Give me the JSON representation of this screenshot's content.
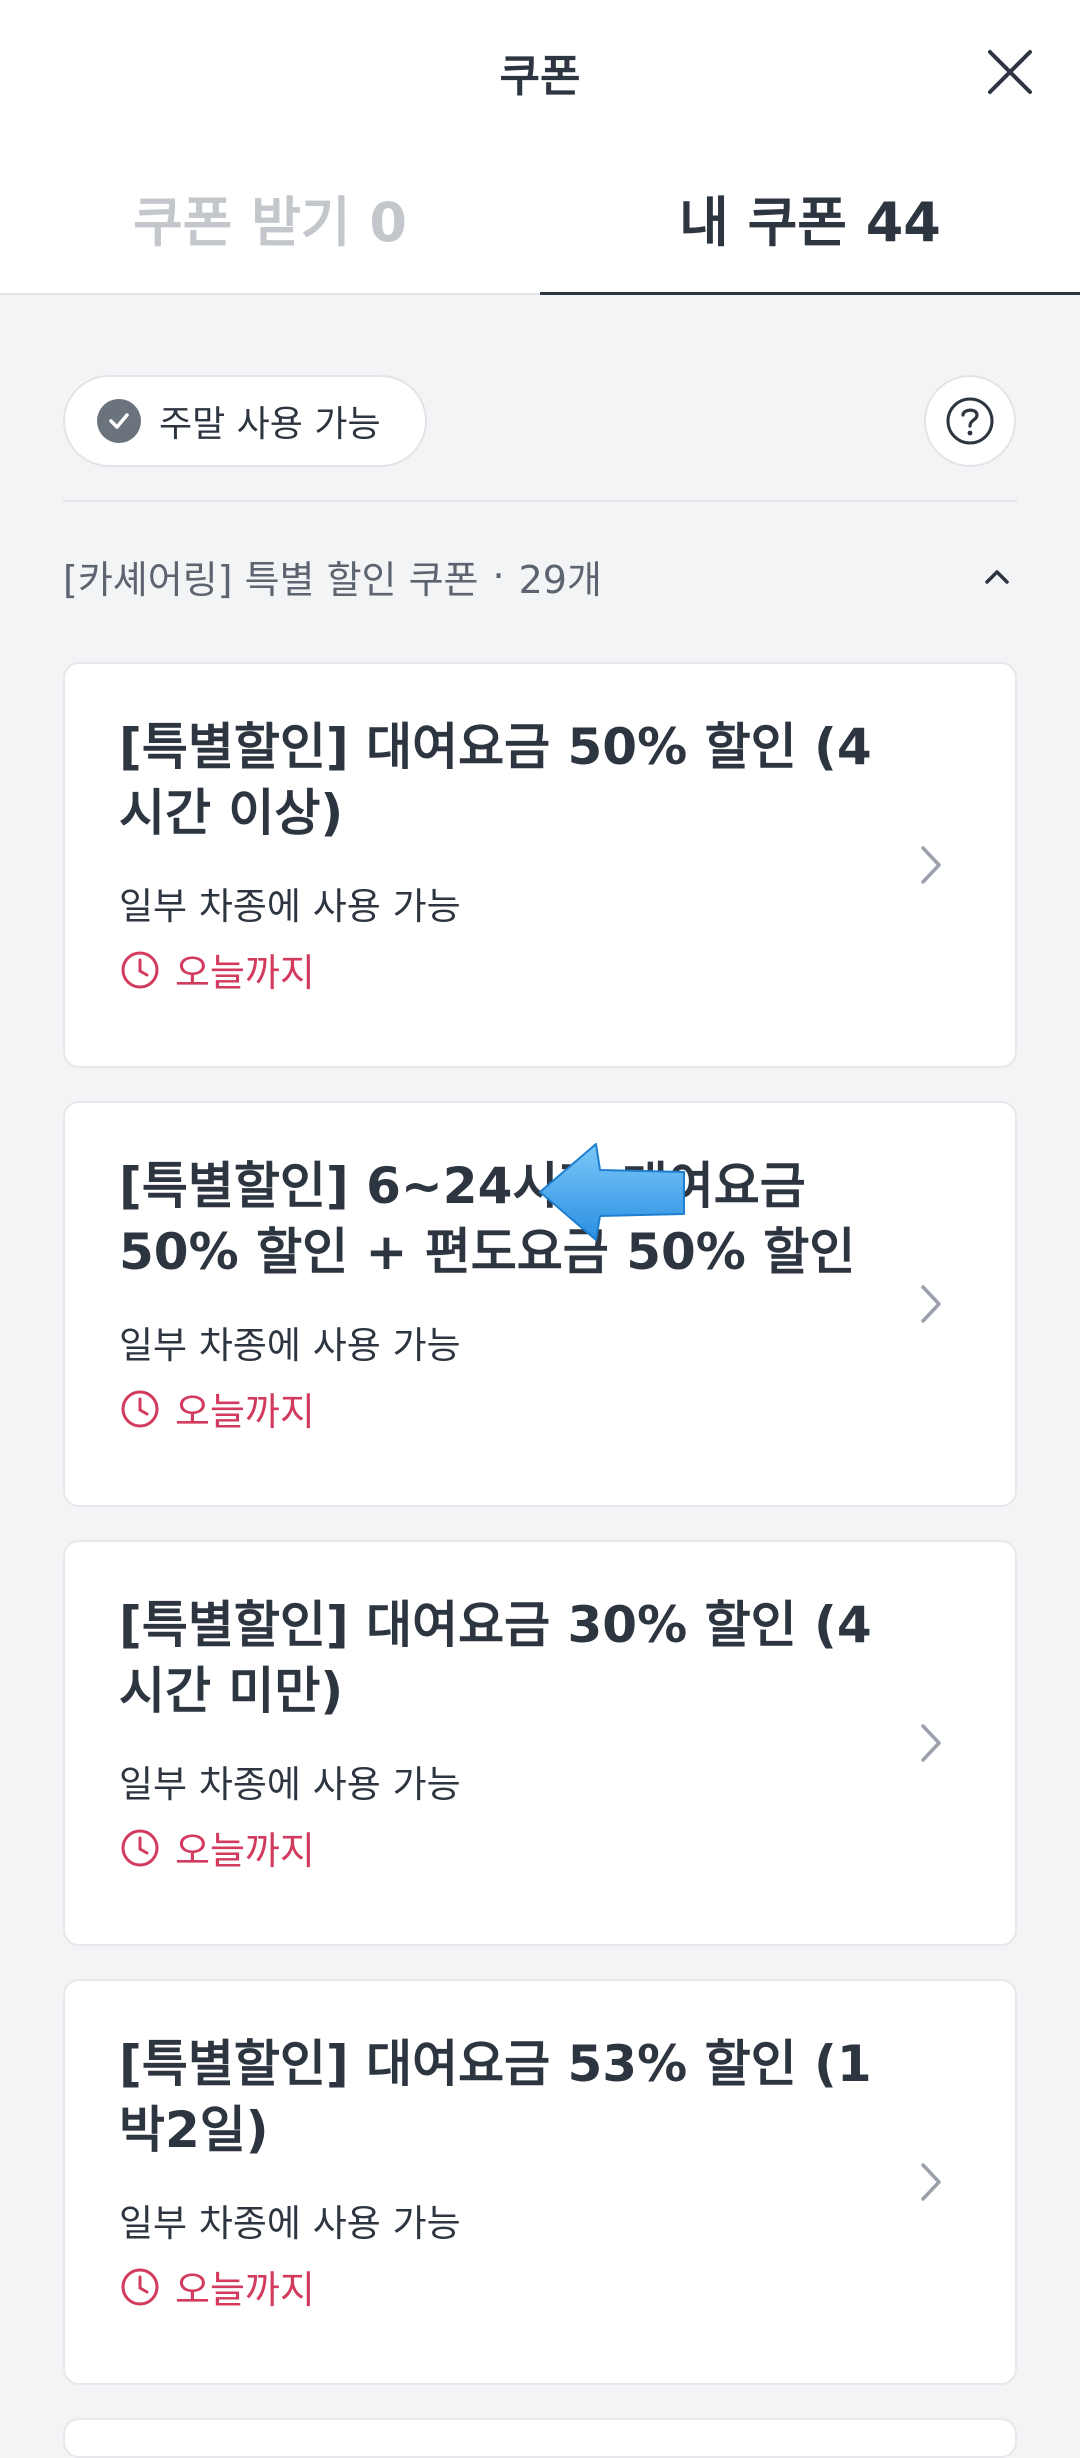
{
  "header": {
    "title": "쿠폰",
    "close_icon": "close-icon"
  },
  "tabs": [
    {
      "label": "쿠폰 받기 0",
      "active": false
    },
    {
      "label": "내 쿠폰 44",
      "active": true
    }
  ],
  "filter": {
    "chip_label": "주말 사용 가능",
    "chip_checked": true
  },
  "section": {
    "title": "[카셰어링] 특별 할인 쿠폰",
    "separator": "·",
    "count": "29개"
  },
  "coupons": [
    {
      "title": "[특별할인] 대여요금 50% 할인 (4시간 이상)",
      "desc": "일부 차종에 사용 가능",
      "expiry": "오늘까지"
    },
    {
      "title": "[특별할인] 6~24시간 대여요금 50% 할인 + 편도요금 50% 할인",
      "desc": "일부 차종에 사용 가능",
      "expiry": "오늘까지"
    },
    {
      "title": "[특별할인] 대여요금 30% 할인 (4시간 미만)",
      "desc": "일부 차종에 사용 가능",
      "expiry": "오늘까지"
    },
    {
      "title": "[특별할인] 대여요금 53% 할인 (1박2일)",
      "desc": "일부 차종에 사용 가능",
      "expiry": "오늘까지"
    }
  ],
  "colors": {
    "text": "#2d3540",
    "muted": "#c3c7cc",
    "expiry": "#d23b5e",
    "background": "#f3f4f5",
    "arrow": "#3aa0ef"
  }
}
